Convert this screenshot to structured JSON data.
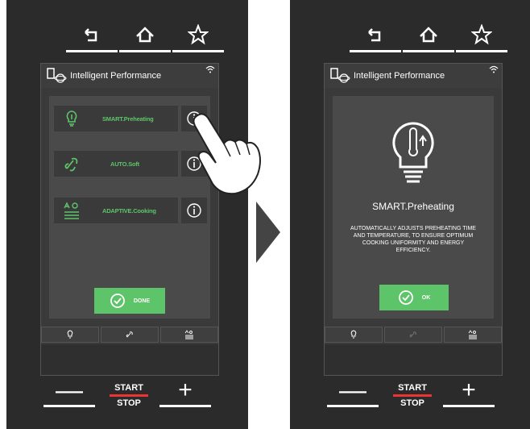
{
  "left": {
    "header_title": "Intelligent Performance",
    "functions": [
      {
        "label": "SMART.Preheating"
      },
      {
        "label": "AUTO.Soft"
      },
      {
        "label": "ADAPTIVE.Cooking"
      }
    ],
    "done_label": "DONE"
  },
  "right": {
    "header_title": "Intelligent Performance",
    "info_title": "SMART.Preheating",
    "info_description": "AUTOMATICALLY ADJUSTS PREHEATING TIME AND TEMPERATURE, TO ENSURE OPTIMUM COOKING UNIFORMITY AND ENERGY EFFICIENCY.",
    "ok_label": "OK"
  },
  "controls": {
    "minus_symbol": "—",
    "plus_symbol": "+",
    "start_label": "START",
    "stop_label": "STOP"
  },
  "colors": {
    "accent": "#5ec46a",
    "panel": "#2b2b2b",
    "start_bar": "#e33333"
  },
  "icons": [
    "back-icon",
    "home-icon",
    "star-icon",
    "lightbulb-thermometer-icon",
    "fan-icon",
    "adaptive-icon",
    "info-icon",
    "check-circle-icon",
    "wifi-icon",
    "oven-atom-icon",
    "hand-pointer-icon"
  ]
}
